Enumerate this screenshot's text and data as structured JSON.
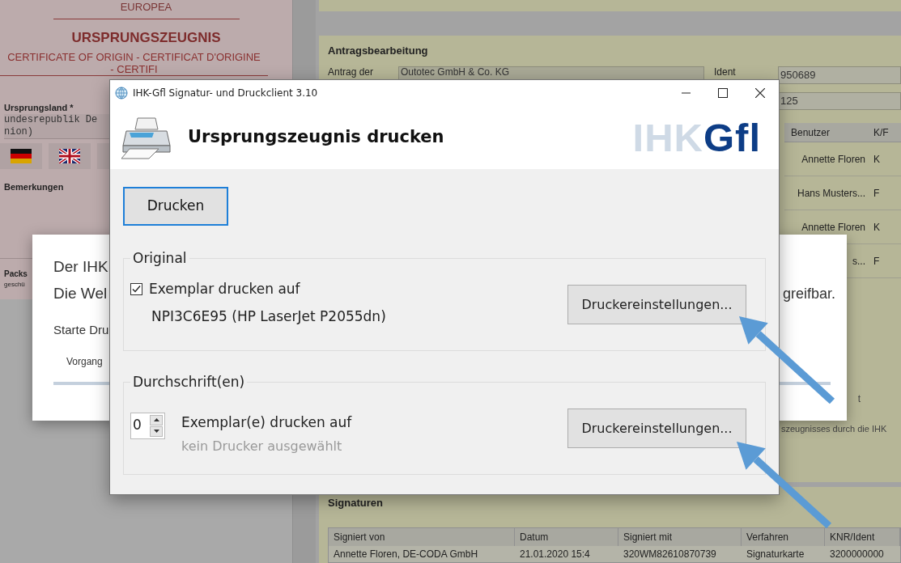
{
  "certificate": {
    "heading": "EUROPEA",
    "title": "URSPRUNGSZEUGNIS",
    "subtitle": "CERTIFICATE OF ORIGIN - CERTIFICAT D'ORIGINE",
    "subtitle_2": "- CERTIFI",
    "country_label": "Ursprungsland *",
    "country_lines": [
      "undesrepublik De",
      "nion)"
    ],
    "remarks_label": "Bemerkungen",
    "packs_label": "Packs",
    "packs_note": "geschü"
  },
  "application": {
    "title": "Antragsbearbeitung",
    "applicant_label": "Antrag der",
    "applicant_value": "Outotec GmbH & Co. KG",
    "ident_label": "Ident",
    "ident_value": "950689",
    "field_2_value": "125",
    "columns": [
      "Benutzer",
      "K/F"
    ],
    "rows": [
      [
        "Annette Floren",
        "K"
      ],
      [
        "Hans Musters...",
        "F"
      ],
      [
        "Annette Floren",
        "K"
      ],
      [
        "s...",
        "F"
      ]
    ],
    "note_1": "t",
    "note_2": "szeugnisses durch die IHK"
  },
  "signatures": {
    "title": "Signaturen",
    "columns": [
      "Signiert von",
      "Datum",
      "Signiert mit",
      "Verfahren",
      "KNR/Ident"
    ],
    "rows": [
      [
        "Annette Floren, DE-CODA GmbH",
        "21.01.2020 15:4",
        "320WM82610870739",
        "Signaturkarte",
        "3200000000"
      ]
    ]
  },
  "progress_popup": {
    "line_1": "Der IHK",
    "line_2": "Die Wel",
    "line_2_end": "greifbar.",
    "status": "Starte Dru",
    "step": "Vorgang",
    "level": 1
  },
  "dialog": {
    "title": "IHK-Gfl Signatur- und Druckclient 3.10",
    "heading": "Ursprungszeugnis drucken",
    "logo": {
      "light": "IHK",
      "dark": "Gfl"
    },
    "print_button": "Drucken",
    "groups": [
      {
        "kind": "original",
        "legend": "Original",
        "checked": true,
        "label": "Exemplar drucken auf",
        "printer": "NPI3C6E95 (HP LaserJet P2055dn)",
        "printer_selected": true,
        "button": "Druckereinstellungen..."
      },
      {
        "kind": "copies",
        "legend": "Durchschrift(en)",
        "count": "0",
        "label": "Exemplar(e) drucken auf",
        "printer": "kein Drucker ausgewählt",
        "printer_selected": false,
        "button": "Druckereinstellungen..."
      }
    ]
  }
}
